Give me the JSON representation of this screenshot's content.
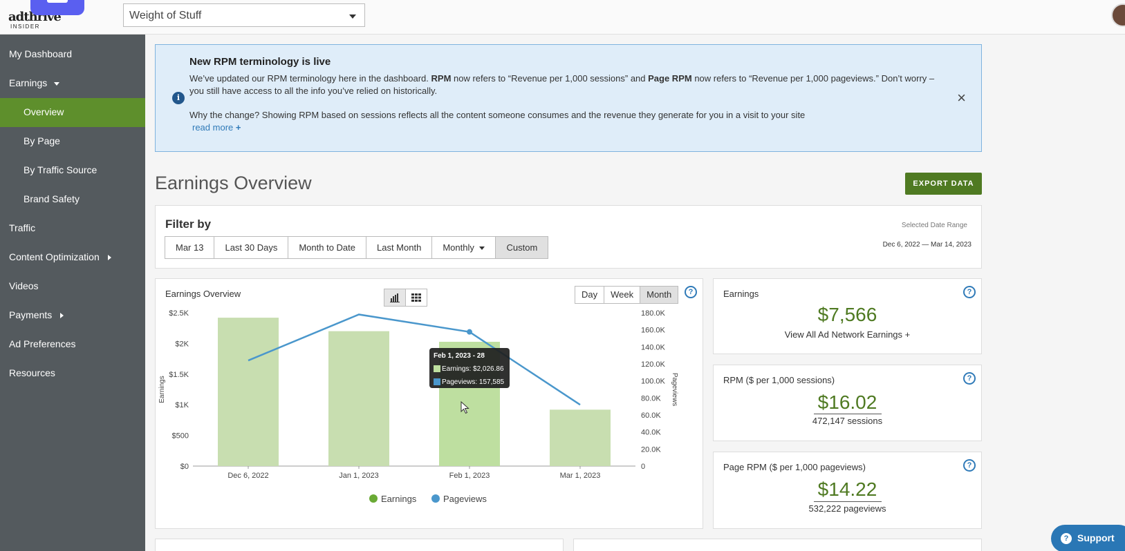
{
  "header": {
    "logo_text": "adthrive",
    "logo_sub": "INSIDER",
    "site_select": "Weight of Stuff"
  },
  "sidebar": {
    "items": [
      {
        "label": "My Dashboard"
      },
      {
        "label": "Earnings"
      },
      {
        "label": "Overview"
      },
      {
        "label": "By Page"
      },
      {
        "label": "By Traffic Source"
      },
      {
        "label": "Brand Safety"
      },
      {
        "label": "Traffic"
      },
      {
        "label": "Content Optimization"
      },
      {
        "label": "Videos"
      },
      {
        "label": "Payments"
      },
      {
        "label": "Ad Preferences"
      },
      {
        "label": "Resources"
      }
    ]
  },
  "notice": {
    "title": "New RPM terminology is live",
    "body_1": "We’ve updated our RPM terminology here in the dashboard. ",
    "body_rpm": "RPM",
    "body_2": " now refers to “Revenue per 1,000 sessions” and ",
    "body_page_rpm": "Page RPM",
    "body_3": " now refers to “Revenue per 1,000 pageviews.” Don’t worry – you still have access to all the info you’ve relied on historically.",
    "why": "Why the change? Showing RPM based on sessions reflects all the content someone consumes and the revenue they generate for you in a visit to your site",
    "read_more": "read more",
    "read_more_icon": "+",
    "close_icon": "×",
    "info_icon": "i"
  },
  "page": {
    "title": "Earnings Overview",
    "export_label": "EXPORT DATA"
  },
  "filter": {
    "label": "Filter by",
    "buttons": [
      "Mar 13",
      "Last 30 Days",
      "Month to Date",
      "Last Month",
      "Monthly",
      "Custom"
    ],
    "selected": "Custom",
    "date_range_label": "Selected Date Range",
    "date_range_value": "Dec 6, 2022 — Mar 14, 2023"
  },
  "chart_panel": {
    "title": "Earnings Overview",
    "periods": [
      "Day",
      "Week",
      "Month"
    ],
    "selected_period": "Month",
    "help_icon": "?"
  },
  "tooltip": {
    "title": "Feb 1, 2023 - 28",
    "earnings": "Earnings: $2,026.86",
    "pageviews": "Pageviews: 157,585"
  },
  "chart_data": {
    "type": "bar",
    "categories": [
      "Dec 6, 2022",
      "Jan 1, 2023",
      "Feb 1, 2023",
      "Mar 1, 2023"
    ],
    "series": [
      {
        "name": "Earnings",
        "type": "bar",
        "axis": "left",
        "values": [
          2420,
          2200,
          2026.86,
          920
        ],
        "color": "#c8deb0"
      },
      {
        "name": "Pageviews",
        "type": "line",
        "axis": "right",
        "values": [
          124000,
          178000,
          157585,
          72000
        ],
        "color": "#4a97cc"
      }
    ],
    "ylabel": "Earnings",
    "y2label": "Pageviews",
    "yticks": [
      "$0",
      "$500",
      "$1K",
      "$1.5K",
      "$2K",
      "$2.5K"
    ],
    "ylim": [
      0,
      2500
    ],
    "y2ticks": [
      "0",
      "20.0K",
      "40.0K",
      "60.0K",
      "80.0K",
      "100.0K",
      "120.0K",
      "140.0K",
      "160.0K",
      "180.0K"
    ],
    "y2lim": [
      0,
      180000
    ],
    "legend": [
      "Earnings",
      "Pageviews"
    ],
    "legend_colors": [
      "#6aaa35",
      "#4a97cc"
    ],
    "legend_position": "bottom",
    "highlight_index": 2
  },
  "cards": {
    "earnings": {
      "label": "Earnings",
      "value": "$7,566",
      "sub": "View All Ad Network Earnings +"
    },
    "rpm": {
      "label": "RPM ($ per 1,000 sessions)",
      "value": "$16.02",
      "sub": "472,147 sessions"
    },
    "page_rpm": {
      "label": "Page RPM ($ per 1,000 pageviews)",
      "value": "$14.22",
      "sub": "532,222 pageviews"
    }
  },
  "support": {
    "label": "Support",
    "icon": "?"
  }
}
